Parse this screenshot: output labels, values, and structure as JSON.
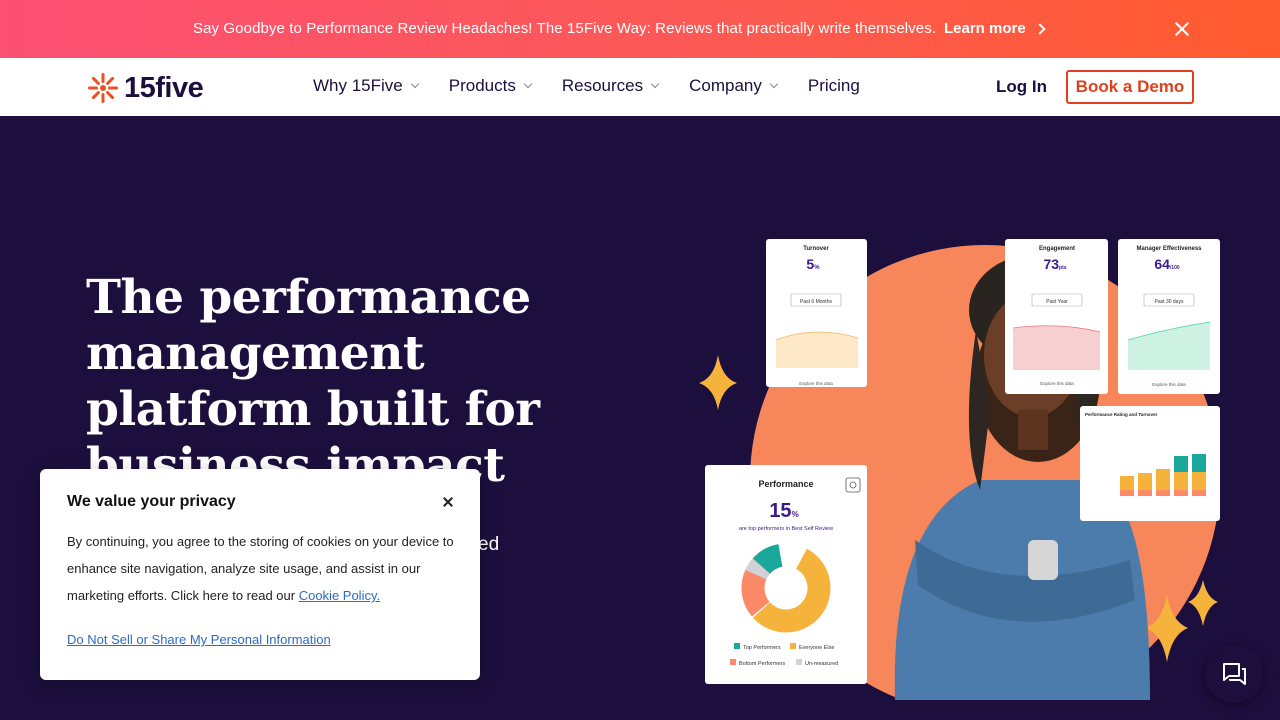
{
  "announcement": {
    "text": "Say Goodbye to Performance Review Headaches! The 15Five Way: Reviews that practically write themselves.",
    "link_label": "Learn more",
    "close_icon": "close-icon"
  },
  "nav": {
    "logo_text": "15five",
    "items": [
      {
        "label": "Why 15Five",
        "has_dropdown": true
      },
      {
        "label": "Products",
        "has_dropdown": true
      },
      {
        "label": "Resources",
        "has_dropdown": true
      },
      {
        "label": "Company",
        "has_dropdown": true
      },
      {
        "label": "Pricing",
        "has_dropdown": false
      }
    ],
    "login_label": "Log In",
    "demo_label": "Book a Demo"
  },
  "hero": {
    "title": "The performance management platform built for business impact",
    "subtitle_fragment": "ed"
  },
  "hero_cards": {
    "turnover": {
      "title": "Turnover",
      "value": "5",
      "unit": "%",
      "range": "Past 6 Months",
      "link": "Explore this data"
    },
    "engagement": {
      "title": "Engagement",
      "value": "73",
      "unit": "pts",
      "range": "Past Year",
      "link": "Explore this data"
    },
    "manager": {
      "title": "Manager Effectiveness",
      "value": "64",
      "unit": "/100",
      "range": "Past 30 days",
      "link": "Explore this data"
    },
    "rating": {
      "title": "Performance Rating and Turnover"
    },
    "performance": {
      "title": "Performance",
      "value": "15",
      "unit": "%",
      "caption": "are top performers in Best Self Review",
      "legend": [
        "Top Performers",
        "Everyone Else",
        "Bottom Performers",
        "Un-measured"
      ]
    }
  },
  "cookie": {
    "title": "We value your privacy",
    "body": "By continuing, you agree to the storing of cookies on your device to enhance site navigation, analyze site usage, and assist in our marketing efforts. Click here to read our ",
    "policy_link": "Cookie Policy.",
    "dns_link": "Do Not Sell or Share My Personal Information"
  },
  "colors": {
    "navy": "#1c0f3e",
    "accent": "#e1401c",
    "banner_start": "#fb4f73",
    "banner_end": "#ff5b2d",
    "link_blue": "#2a6ac8"
  }
}
